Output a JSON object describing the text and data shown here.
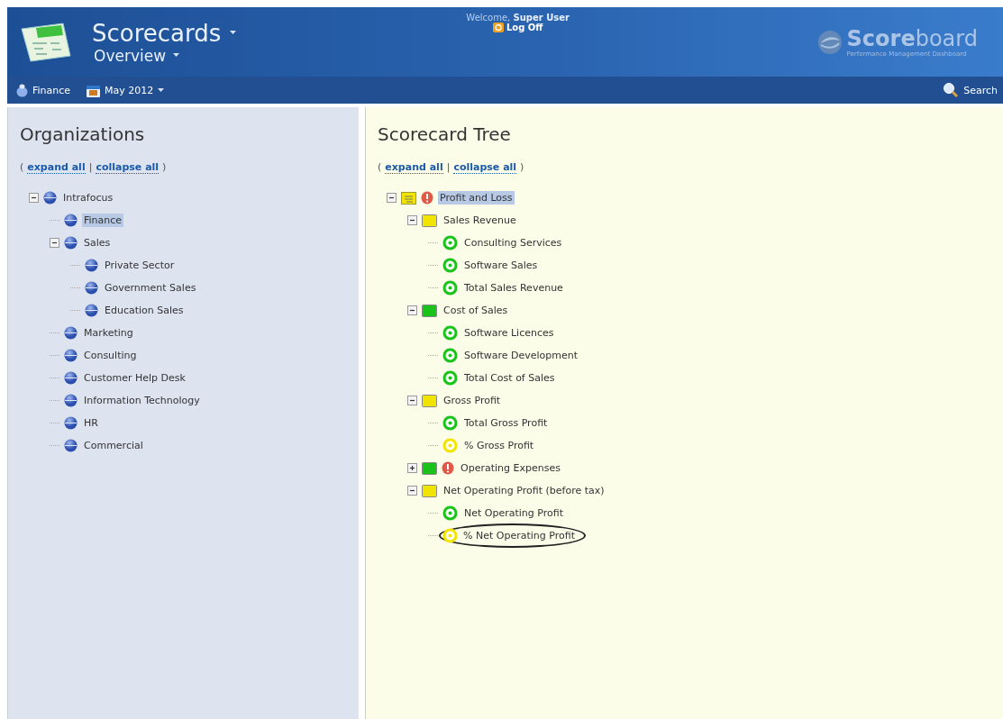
{
  "header": {
    "app_title": "Scorecards",
    "view_title": "Overview",
    "welcome": "Welcome,",
    "user": "Super User",
    "log_off": "Log Off",
    "logo": {
      "strong": "Score",
      "light": "board",
      "tagline": "Performance Management Dashboard"
    }
  },
  "nav": {
    "organization": "Finance",
    "period": "May 2012",
    "search": "Search"
  },
  "organizations": {
    "title": "Organizations",
    "open_paren": "(",
    "expand_all": "expand all",
    "separator": "|",
    "collapse_all": "collapse all",
    "close_paren": ")",
    "tree": [
      {
        "label": "Intrafocus",
        "selected": false,
        "expanded": true,
        "children": [
          {
            "label": "Finance",
            "selected": true
          },
          {
            "label": "Sales",
            "selected": false,
            "expanded": true,
            "children": [
              {
                "label": "Private Sector",
                "selected": false
              },
              {
                "label": "Government Sales",
                "selected": false
              },
              {
                "label": "Education Sales",
                "selected": false
              }
            ]
          },
          {
            "label": "Marketing",
            "selected": false
          },
          {
            "label": "Consulting",
            "selected": false
          },
          {
            "label": "Customer Help Desk",
            "selected": false
          },
          {
            "label": "Information Technology",
            "selected": false
          },
          {
            "label": "HR",
            "selected": false
          },
          {
            "label": "Commercial",
            "selected": false
          }
        ]
      }
    ]
  },
  "scorecard": {
    "title": "Scorecard Tree",
    "open_paren": "(",
    "expand_all": "expand all",
    "separator": "|",
    "collapse_all": "collapse all",
    "close_paren": ")",
    "tree": [
      {
        "label": "Profit and Loss",
        "kind": "scorecard",
        "color": "#f1e400",
        "alert": true,
        "selected": true,
        "expanded": true,
        "children": [
          {
            "label": "Sales Revenue",
            "kind": "perspective",
            "color": "#f1e400",
            "alert": false,
            "selected": false,
            "expanded": true,
            "children": [
              {
                "label": "Consulting Services",
                "kind": "measure",
                "color": "#19c319",
                "selected": false
              },
              {
                "label": "Software Sales",
                "kind": "measure",
                "color": "#19c319",
                "selected": false
              },
              {
                "label": "Total Sales Revenue",
                "kind": "measure",
                "color": "#19c319",
                "selected": false
              }
            ]
          },
          {
            "label": "Cost of Sales",
            "kind": "perspective",
            "color": "#19c319",
            "alert": false,
            "selected": false,
            "expanded": true,
            "children": [
              {
                "label": "Software Licences",
                "kind": "measure",
                "color": "#19c319",
                "selected": false
              },
              {
                "label": "Software Development",
                "kind": "measure",
                "color": "#19c319",
                "selected": false
              },
              {
                "label": "Total Cost of Sales",
                "kind": "measure",
                "color": "#19c319",
                "selected": false
              }
            ]
          },
          {
            "label": "Gross Profit",
            "kind": "perspective",
            "color": "#f1e400",
            "alert": false,
            "selected": false,
            "expanded": true,
            "children": [
              {
                "label": "Total Gross Profit",
                "kind": "measure",
                "color": "#19c319",
                "selected": false
              },
              {
                "label": "% Gross Profit",
                "kind": "measure",
                "color": "#f1e400",
                "selected": false
              }
            ]
          },
          {
            "label": "Operating Expenses",
            "kind": "perspective",
            "color": "#19c319",
            "alert": true,
            "selected": false,
            "expanded": false
          },
          {
            "label": "Net Operating Profit (before tax)",
            "kind": "perspective",
            "color": "#f1e400",
            "alert": false,
            "selected": false,
            "expanded": true,
            "children": [
              {
                "label": "Net Operating Profit",
                "kind": "measure",
                "color": "#19c319",
                "selected": false
              },
              {
                "label": "% Net Operating Profit",
                "kind": "measure",
                "color": "#f1e400",
                "selected": false,
                "circled": true
              }
            ]
          }
        ]
      }
    ]
  }
}
